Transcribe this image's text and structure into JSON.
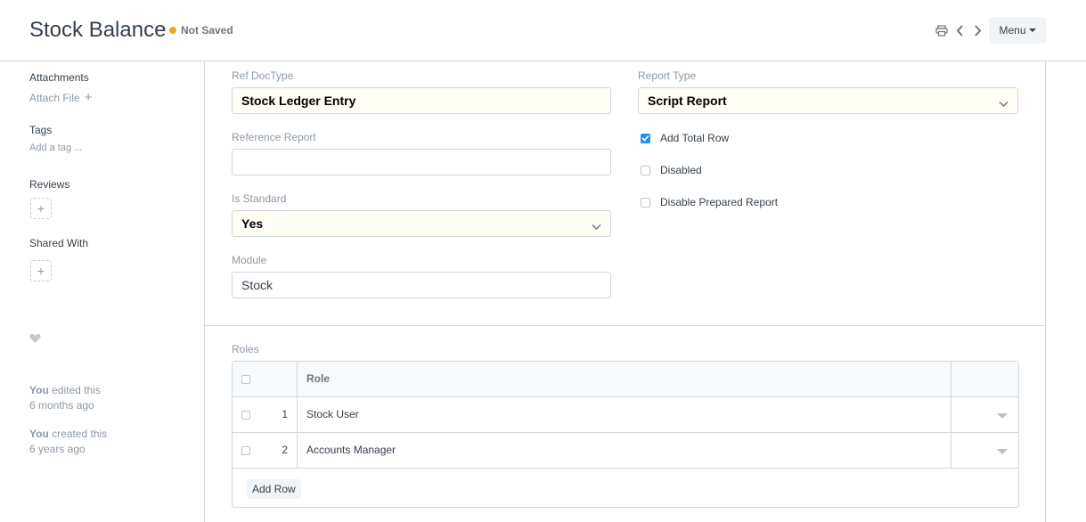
{
  "header": {
    "title": "Stock Balance",
    "status": "Not Saved",
    "status_color": "#f5a623",
    "icons": [
      "print-icon",
      "prev-icon",
      "next-icon"
    ],
    "menu_label": "Menu"
  },
  "sidebar": {
    "attachments_label": "Attachments",
    "attach_file_label": "Attach File",
    "tags_label": "Tags",
    "add_tag_label": "Add a tag ...",
    "reviews_label": "Reviews",
    "shared_with_label": "Shared With",
    "activity": [
      {
        "actor": "You",
        "action": "edited this",
        "when": "6 months ago"
      },
      {
        "actor": "You",
        "action": "created this",
        "when": "6 years ago"
      }
    ]
  },
  "form": {
    "ref_doctype": {
      "label": "Ref DocType",
      "value": "Stock Ledger Entry"
    },
    "reference_report": {
      "label": "Reference Report",
      "value": ""
    },
    "is_standard": {
      "label": "Is Standard",
      "value": "Yes"
    },
    "module": {
      "label": "Module",
      "value": "Stock"
    },
    "report_type": {
      "label": "Report Type",
      "value": "Script Report"
    },
    "add_total_row": {
      "label": "Add Total Row",
      "checked": true
    },
    "disabled": {
      "label": "Disabled",
      "checked": false
    },
    "disable_prepared_report": {
      "label": "Disable Prepared Report",
      "checked": false
    }
  },
  "roles": {
    "section_label": "Roles",
    "column_header": "Role",
    "rows": [
      {
        "idx": "1",
        "role": "Stock User"
      },
      {
        "idx": "2",
        "role": "Accounts Manager"
      }
    ],
    "add_row_label": "Add Row"
  }
}
